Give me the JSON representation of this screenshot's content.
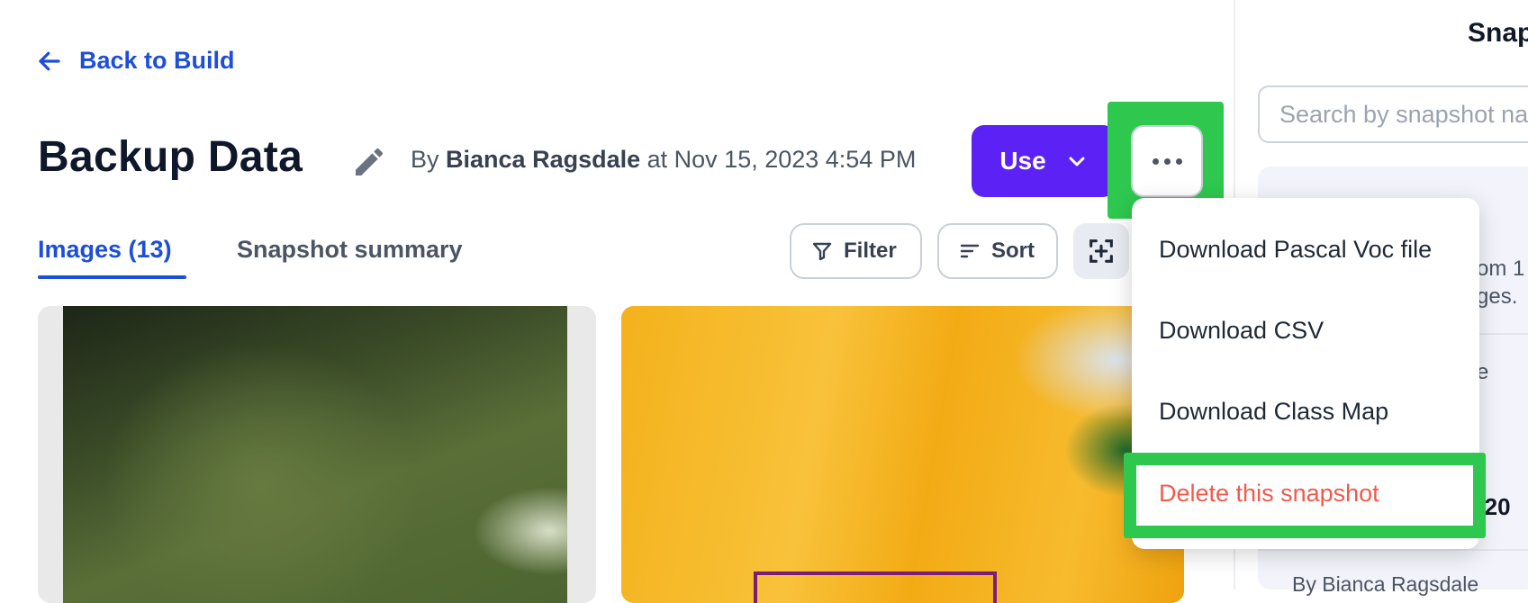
{
  "header": {
    "back_label": "Back to Build",
    "title": "Backup Data",
    "byline_prefix": "By",
    "author": "Bianca Ragsdale",
    "byline_at": "at Nov 15, 2023 4:54 PM"
  },
  "actions": {
    "use_label": "Use",
    "more_icon": "ellipsis-icon"
  },
  "tabs": [
    {
      "label": "Images (13)",
      "active": true
    },
    {
      "label": "Snapshot summary",
      "active": false
    }
  ],
  "toolbar": {
    "filter_label": "Filter",
    "sort_label": "Sort"
  },
  "menu": {
    "items": [
      {
        "label": "Download Pascal Voc file"
      },
      {
        "label": "Download CSV"
      },
      {
        "label": "Download Class Map"
      },
      {
        "label": "Delete this snapshot",
        "danger": true
      }
    ]
  },
  "panel": {
    "title": "Snap",
    "search_placeholder": "Search by snapshot na",
    "line1": "om 1",
    "line2": "ges.",
    "line3": "e",
    "line4": "-20",
    "line5": "By Bianca Ragsdale"
  },
  "colors": {
    "accent": "#1d4ed8",
    "primary_button": "#5b21f5",
    "highlight": "#2ec84f",
    "danger": "#f05a4b"
  }
}
